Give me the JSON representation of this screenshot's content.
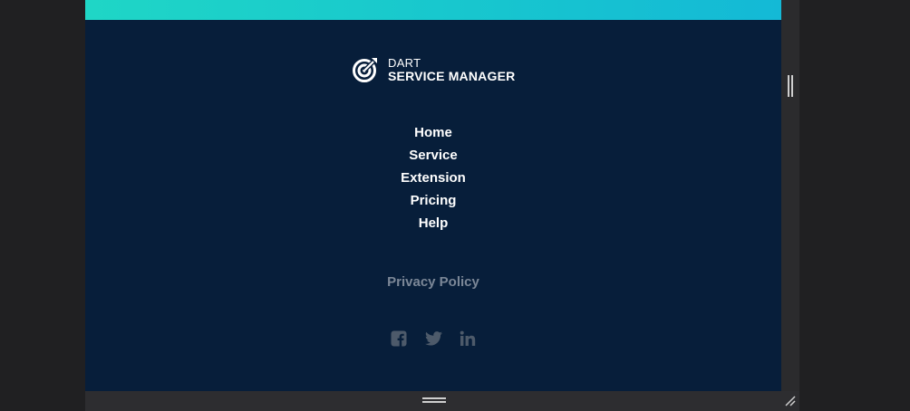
{
  "logo": {
    "line1": "DART",
    "line2": "SERVICE MANAGER",
    "icon": "target-arrow-icon"
  },
  "nav": {
    "items": [
      {
        "label": "Home"
      },
      {
        "label": "Service"
      },
      {
        "label": "Extension"
      },
      {
        "label": "Pricing"
      },
      {
        "label": "Help"
      }
    ]
  },
  "footer": {
    "privacy_label": "Privacy Policy"
  },
  "social": {
    "icons": [
      "facebook-icon",
      "twitter-icon",
      "linkedin-icon"
    ]
  },
  "colors": {
    "background": "#071e3a",
    "accent_gradient_start": "#1fd6c6",
    "accent_gradient_end": "#14b9d6",
    "text": "#ffffff",
    "muted": "#7b8797",
    "social_icon": "#4d5a6a"
  }
}
